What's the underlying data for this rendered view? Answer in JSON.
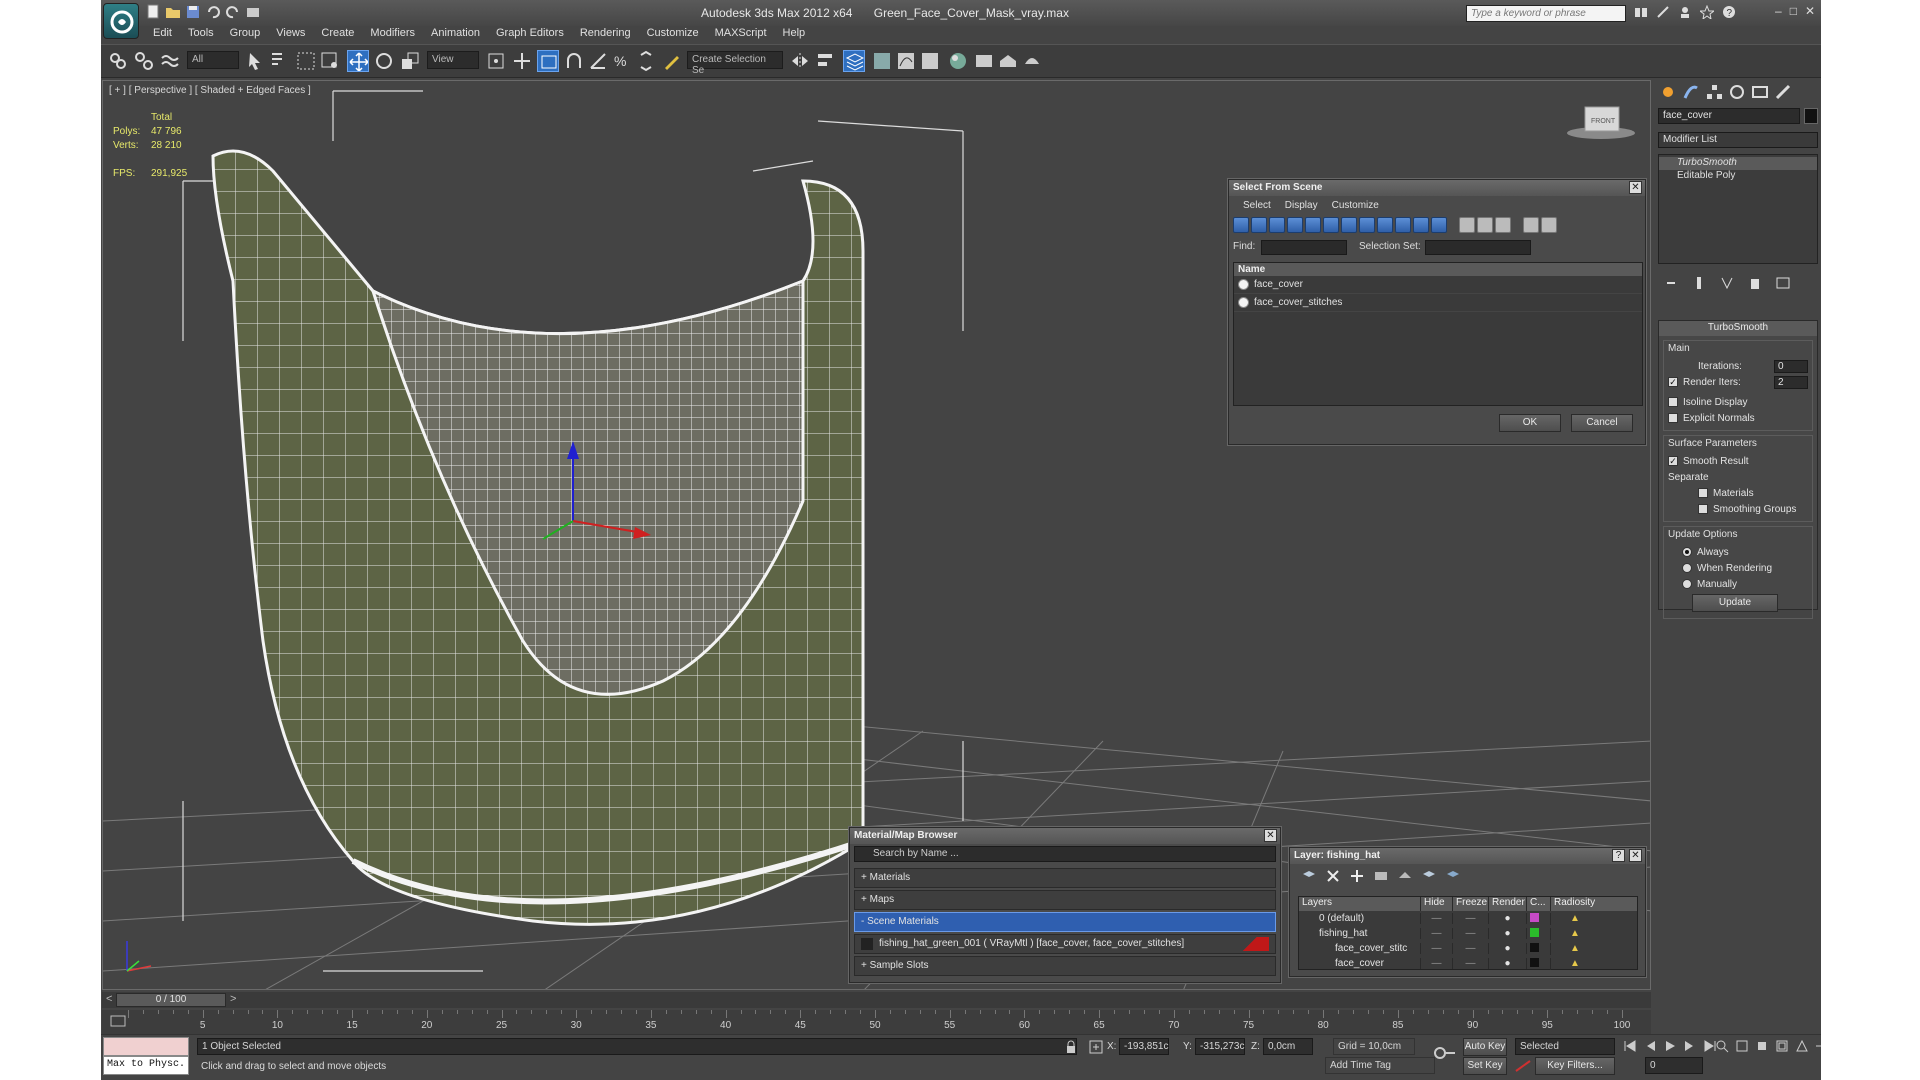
{
  "app": {
    "title": "Autodesk 3ds Max  2012 x64",
    "file": "Green_Face_Cover_Mask_vray.max",
    "search_placeholder": "Type a keyword or phrase"
  },
  "menu": [
    "Edit",
    "Tools",
    "Group",
    "Views",
    "Create",
    "Modifiers",
    "Animation",
    "Graph Editors",
    "Rendering",
    "Customize",
    "MAXScript",
    "Help"
  ],
  "toolbar": {
    "filter": "All",
    "ref_coord": "View",
    "selection_set": "Create Selection Se"
  },
  "viewport": {
    "label": "[ + ] [ Perspective ] [ Shaded + Edged Faces ]",
    "stats": {
      "header": "Total",
      "polys_label": "Polys:",
      "polys": "47 796",
      "verts_label": "Verts:",
      "verts": "28 210",
      "fps_label": "FPS:",
      "fps": "291,925"
    },
    "viewcube": "FRONT"
  },
  "select_from_scene": {
    "title": "Select From Scene",
    "menu": [
      "Select",
      "Display",
      "Customize"
    ],
    "find_label": "Find:",
    "selset_label": "Selection Set:",
    "col_name": "Name",
    "items": [
      "face_cover",
      "face_cover_stitches"
    ],
    "ok": "OK",
    "cancel": "Cancel"
  },
  "command_panel": {
    "object_name": "face_cover",
    "modifier_list": "Modifier List",
    "stack": [
      "TurboSmooth",
      "Editable Poly"
    ],
    "rollout_title": "TurboSmooth",
    "main_label": "Main",
    "iterations_label": "Iterations:",
    "iterations": "0",
    "render_iters_label": "Render Iters:",
    "render_iters": "2",
    "isoline": "Isoline Display",
    "explicit_normals": "Explicit Normals",
    "surface_params": "Surface Parameters",
    "smooth_result": "Smooth Result",
    "separate": "Separate",
    "materials": "Materials",
    "smoothing_groups": "Smoothing Groups",
    "update_options": "Update Options",
    "always": "Always",
    "when_rendering": "When Rendering",
    "manually": "Manually",
    "update": "Update"
  },
  "material_browser": {
    "title": "Material/Map Browser",
    "search_placeholder": "Search by Name ...",
    "rows": [
      "+ Materials",
      "+ Maps",
      "- Scene Materials"
    ],
    "material_entry": "fishing_hat_green_001  ( VRayMtl )  [face_cover, face_cover_stitches]",
    "sample_slots": "+ Sample Slots"
  },
  "layer_manager": {
    "title": "Layer: fishing_hat",
    "cols": [
      "Layers",
      "Hide",
      "Freeze",
      "Render",
      "C...",
      "Radiosity"
    ],
    "rows": [
      {
        "name": "0 (default)",
        "color": "#c74ac7"
      },
      {
        "name": "fishing_hat",
        "color": "#2bbd2b"
      },
      {
        "name": "face_cover_stitc",
        "color": "#111111"
      },
      {
        "name": "face_cover",
        "color": "#111111"
      }
    ]
  },
  "timeline": {
    "frame": "0 / 100",
    "ticks": [
      "5",
      "10",
      "15",
      "20",
      "25",
      "30",
      "35",
      "40",
      "45",
      "50",
      "55",
      "60",
      "65",
      "70",
      "75",
      "80",
      "85",
      "90",
      "95",
      "100"
    ]
  },
  "status": {
    "maxscript": "Max to Physc.",
    "selected": "1 Object Selected",
    "prompt": "Click and drag to select and move objects",
    "x_label": "X:",
    "x": "-193,851c",
    "y_label": "Y:",
    "y": "-315,273c",
    "z_label": "Z:",
    "z": "0,0cm",
    "grid": "Grid = 10,0cm",
    "auto_key": "Auto Key",
    "set_key": "Set Key",
    "key_mode": "Selected",
    "key_filters": "Key Filters...",
    "add_time_tag": "Add Time Tag",
    "frame_field": "0"
  }
}
